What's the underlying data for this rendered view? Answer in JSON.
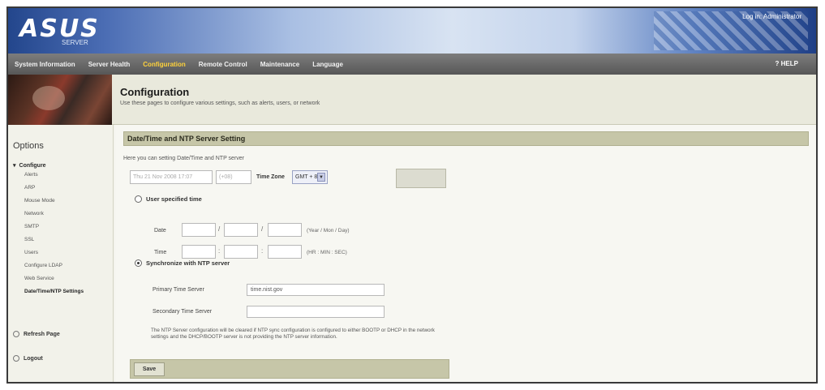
{
  "header": {
    "logo": "ASUS",
    "logo_sub": "SERVER",
    "top_link": "Log in: Administrator"
  },
  "nav": {
    "items": [
      "System Information",
      "Server Health",
      "Configuration",
      "Remote Control",
      "Maintenance",
      "Language"
    ],
    "active_index": 2,
    "help": "? HELP"
  },
  "page": {
    "title": "Configuration",
    "description": "Use these pages to configure various settings, such as alerts, users, or network"
  },
  "sidebar": {
    "title": "Options",
    "parent": "Configure",
    "children": [
      "Alerts",
      "ARP",
      "Mouse Mode",
      "Network",
      "SMTP",
      "SSL",
      "Users",
      "Configure LDAP",
      "Web Service",
      "Date/Time/NTP Settings"
    ],
    "active_index": 9,
    "refresh": "Refresh Page",
    "logout": "Logout"
  },
  "section": {
    "title": "Date/Time and NTP Server Setting",
    "intro": "Here you can setting Date/Time and NTP server",
    "current_time": "Thu 21 Nov 2008 17:07",
    "current_tz": "(+08)",
    "tz_label": "Time Zone",
    "tz_value": "GMT + 8",
    "user_radio": "User specified time",
    "date_label": "Date",
    "date_hint": "(Year / Mon / Day)",
    "time_label": "Time",
    "time_hint": "(HR : MIN : SEC)",
    "ntp_radio": "Synchronize with NTP server",
    "primary_label": "Primary Time Server",
    "primary_value": "time.nist.gov",
    "secondary_label": "Secondary Time Server",
    "secondary_value": "",
    "note": "The NTP Server configuration will be cleared if NTP sync configuration is configured to either BOOTP or DHCP in the network settings and the DHCP/BOOTP server is not providing the NTP server information.",
    "save": "Save"
  }
}
